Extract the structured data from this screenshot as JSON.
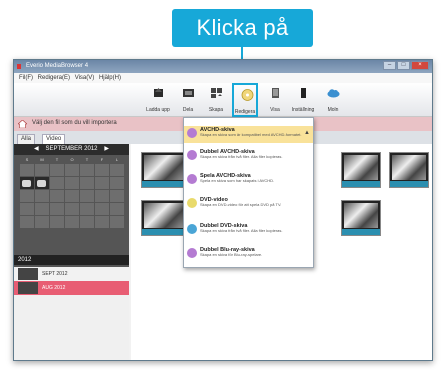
{
  "callout": {
    "label": "Klicka på"
  },
  "window": {
    "title": "Everio MediaBrowser 4",
    "menu": [
      "Fil(F)",
      "Redigera(E)",
      "Visa(V)",
      "Hjälp(H)"
    ],
    "toolbar": [
      {
        "label": "Ladda upp",
        "icon": "upload-icon"
      },
      {
        "label": "Dela",
        "icon": "share-icon"
      },
      {
        "label": "Skapa",
        "icon": "disc-create-icon",
        "highlight": true
      },
      {
        "label": "Redigera",
        "icon": "edit-icon"
      },
      {
        "label": "Visa",
        "icon": "view-icon"
      },
      {
        "label": "Inställning",
        "icon": "settings-icon"
      },
      {
        "label": "Moln",
        "icon": "cloud-icon"
      }
    ],
    "infobar": "Välj den fil som du vill importera",
    "tabs": [
      "Alla",
      "Video"
    ],
    "calendar": {
      "month": "SEPTEMBER 2012",
      "dow": [
        "S",
        "M",
        "T",
        "O",
        "T",
        "F",
        "L"
      ]
    },
    "year": "2012",
    "months": [
      "SEPT 2012",
      "AUG 2012"
    ],
    "menu_items": [
      {
        "title": "AVCHD-skiva",
        "desc": "Skapa en skiva som är kompatibel med AVCHD-formatet."
      },
      {
        "title": "Dubbel AVCHD-skiva",
        "desc": "Skapa en skiva från två filer. Alla filer kopieras."
      },
      {
        "title": "Spela AVCHD-skiva",
        "desc": "Spela en skiva som har skapats i AVCHD."
      },
      {
        "title": "DVD-video",
        "desc": "Skapa en DVD-video för att spela DVD på TV."
      },
      {
        "title": "Dubbel DVD-skiva",
        "desc": "Skapa en skiva från två filer. Alla filer kopieras."
      },
      {
        "title": "Dubbel Blu-ray-skiva",
        "desc": "Skapa en skiva för Blu-ray-spelare."
      }
    ]
  }
}
